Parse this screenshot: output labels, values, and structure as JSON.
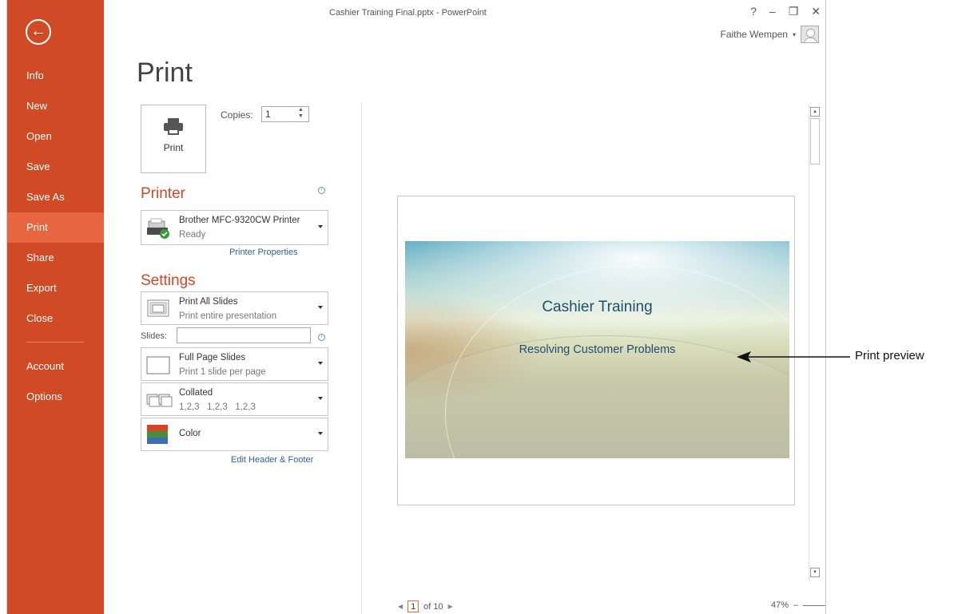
{
  "window": {
    "title": "Cashier Training Final.pptx - PowerPoint",
    "help_label": "?",
    "minimize_label": "–",
    "restore_label": "❐",
    "close_label": "✕",
    "user_name": "Faithe Wempen"
  },
  "sidebar": {
    "back_glyph": "←",
    "items": [
      {
        "label": "Info"
      },
      {
        "label": "New"
      },
      {
        "label": "Open"
      },
      {
        "label": "Save"
      },
      {
        "label": "Save As"
      },
      {
        "label": "Print",
        "active": true
      },
      {
        "label": "Share"
      },
      {
        "label": "Export"
      },
      {
        "label": "Close"
      },
      {
        "label": "Account"
      },
      {
        "label": "Options"
      }
    ],
    "accent_color": "#d04a25",
    "active_color": "#e8663f"
  },
  "main": {
    "page_title": "Print",
    "print_button_label": "Print",
    "copies_label": "Copies:",
    "copies_value": "1",
    "printer_section": "Printer",
    "printer_name": "Brother MFC-9320CW Printer",
    "printer_status": "Ready",
    "printer_properties_link": "Printer Properties",
    "settings_section": "Settings",
    "print_range_title": "Print All Slides",
    "print_range_sub": "Print entire presentation",
    "slides_label": "Slides:",
    "slides_value": "",
    "layout_title": "Full Page Slides",
    "layout_sub": "Print 1 slide per page",
    "collation_title": "Collated",
    "collation_sub": "1,2,3   1,2,3   1,2,3",
    "color_title": "Color",
    "edit_header_footer_link": "Edit Header & Footer",
    "section_color": "#d24726"
  },
  "preview": {
    "slide_title": "Cashier Training",
    "slide_subtitle": "Resolving Customer Problems",
    "current_page": "1",
    "of_pages": "of 10",
    "zoom_level": "47%",
    "zoom_minus": "–",
    "zoom_plus": "+"
  },
  "callout": {
    "label": "Print preview"
  }
}
